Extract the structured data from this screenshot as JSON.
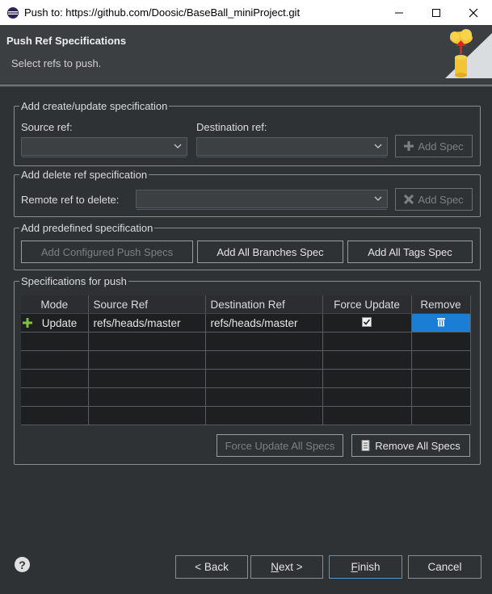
{
  "window": {
    "title": "Push to: https://github.com/Doosic/BaseBall_miniProject.git"
  },
  "header": {
    "title": "Push Ref Specifications",
    "subtitle": "Select refs to push."
  },
  "create_group": {
    "legend": "Add create/update specification",
    "source_label": "Source ref:",
    "source_value": "",
    "dest_label": "Destination ref:",
    "dest_value": "",
    "add_spec": "Add Spec"
  },
  "delete_group": {
    "legend": "Add delete ref specification",
    "remote_label": "Remote ref to delete:",
    "remote_value": "",
    "add_spec": "Add Spec"
  },
  "predefined_group": {
    "legend": "Add predefined specification",
    "configured": "Add Configured Push Specs",
    "branches": "Add All Branches Spec",
    "tags": "Add All Tags Spec"
  },
  "specs_group": {
    "legend": "Specifications for push",
    "columns": [
      "Mode",
      "Source Ref",
      "Destination Ref",
      "Force Update",
      "Remove"
    ],
    "rows": [
      {
        "mode": "Update",
        "source": "refs/heads/master",
        "dest": "refs/heads/master",
        "force": true
      }
    ],
    "force_all": "Force Update All Specs",
    "remove_all": "Remove All Specs"
  },
  "footer": {
    "back": "< Back",
    "next": "Next >",
    "finish": "Finish",
    "cancel": "Cancel"
  },
  "colors": {
    "background": "#2f3235",
    "header": "#3b3f42",
    "selection": "#1a7fd4",
    "table": "#1e1f21"
  }
}
